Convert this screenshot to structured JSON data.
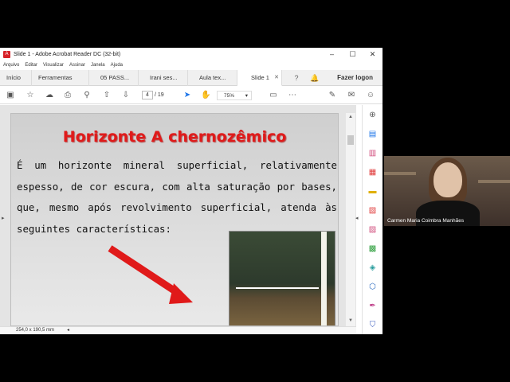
{
  "window": {
    "title": "Slide 1 - Adobe Acrobat Reader DC (32-bit)",
    "minimize": "–",
    "maximize": "☐",
    "close": "✕"
  },
  "menu": [
    "Arquivo",
    "Editar",
    "Visualizar",
    "Assinar",
    "Janela",
    "Ajuda"
  ],
  "tabs": {
    "home": "Início",
    "tools": "Ferramentas",
    "docs": [
      "05 PASS...",
      "Irani ses...",
      "Aula tex...",
      "Slide 1"
    ],
    "login": "Fazer logon"
  },
  "toolbar": {
    "current_page": "4",
    "page_sep": "/",
    "total_pages": "19",
    "zoom": "75%"
  },
  "slide": {
    "title": "Horizonte A chernozêmico",
    "body": "É um horizonte mineral superficial, relativamente espesso, de cor escura, com alta saturação por bases, que, mesmo após revolvimento superficial, atenda às seguintes características:"
  },
  "status": {
    "page_size": "254,0 x 190,5 mm"
  },
  "webcam": {
    "participant": "Carmen Maria Coimbra Manhães"
  },
  "colors": {
    "title_red": "#e01a1a",
    "accent_blue": "#1a73e8"
  }
}
